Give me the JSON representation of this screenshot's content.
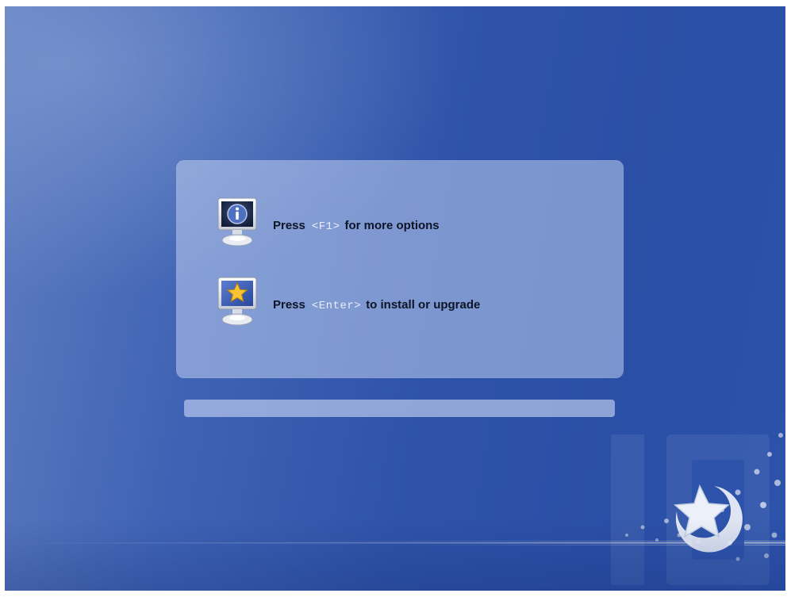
{
  "colors": {
    "background_start": "#5e7cc0",
    "background_end": "#2a4fa6",
    "panel": "#c0cff0",
    "key_text": "#e8eefb",
    "label_text": "#0d1426"
  },
  "options": [
    {
      "icon": "info-monitor-icon",
      "prefix": "Press",
      "key": "<F1>",
      "suffix": "for more options"
    },
    {
      "icon": "star-monitor-icon",
      "prefix": "Press",
      "key": "<Enter>",
      "suffix": "to install or upgrade"
    }
  ],
  "progress": {
    "fraction": 0.0
  },
  "branding": {
    "watermark_icon": "version-watermark-icon",
    "logo_icon": "shooting-star-moon-icon"
  }
}
